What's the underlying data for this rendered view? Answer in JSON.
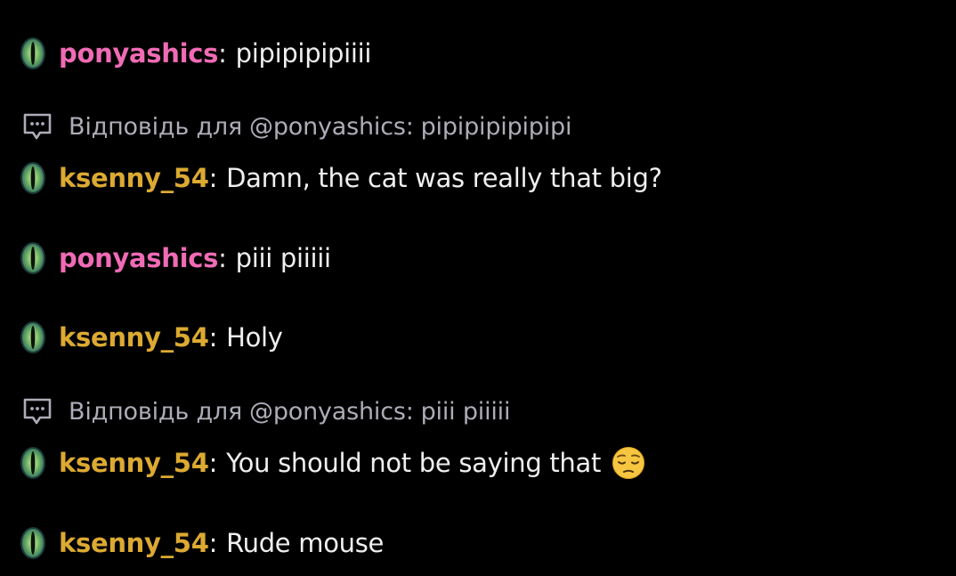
{
  "colors": {
    "background": "#000000",
    "message_text": "#efeff1",
    "reply_text": "#adadb8",
    "ponyashics": "#f06bb5",
    "ksenny_54": "#dcaa32"
  },
  "messages": [
    {
      "user": "ponyashics",
      "colon": ":",
      "text": "pipipipipiiii",
      "badge_icon": "cat-eye-badge-icon"
    },
    {
      "reply": {
        "label": "Відповідь для",
        "target": "@ponyashics:",
        "text": "pipipipipipipi"
      }
    },
    {
      "user": "ksenny_54",
      "colon": ":",
      "text": "Damn, the cat was really that big?",
      "badge_icon": "cat-eye-badge-icon"
    },
    {
      "user": "ponyashics",
      "colon": ":",
      "text": "piii piiiii",
      "badge_icon": "cat-eye-badge-icon"
    },
    {
      "user": "ksenny_54",
      "colon": ":",
      "text": "Holy",
      "badge_icon": "cat-eye-badge-icon"
    },
    {
      "reply": {
        "label": "Відповідь для",
        "target": "@ponyashics:",
        "text": "piii piiiii"
      }
    },
    {
      "user": "ksenny_54",
      "colon": ":",
      "text": "You should not be saying that",
      "emoji": "pensive-face-emoji",
      "badge_icon": "cat-eye-badge-icon"
    },
    {
      "user": "ksenny_54",
      "colon": ":",
      "text": "Rude mouse",
      "badge_icon": "cat-eye-badge-icon"
    }
  ]
}
